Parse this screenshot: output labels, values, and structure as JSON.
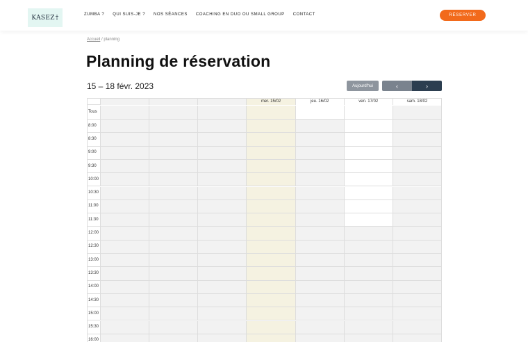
{
  "header": {
    "logo_text": "KASEZ",
    "logo_mark": "†",
    "nav": [
      "ZUMBA ?",
      "QUI SUIS-JE ?",
      "NOS SÉANCES",
      "COACHING EN DUO OU SMALL GROUP",
      "CONTACT"
    ],
    "reserve_label": "RÉSERVER"
  },
  "breadcrumb": {
    "home": "Accueil",
    "separator": "/",
    "current": "planning"
  },
  "page_title": "Planning de réservation",
  "toolbar": {
    "date_range": "15 – 18 févr. 2023",
    "today_label": "Aujourd'hui",
    "prev_icon": "‹",
    "next_icon": "›"
  },
  "calendar": {
    "columns": [
      "",
      "",
      "",
      "mer. 15/02",
      "jeu. 16/02",
      "ven. 17/02",
      "sam. 18/02"
    ],
    "all_day_label": "Tous",
    "times": [
      "8:00",
      "8:30",
      "9:00",
      "9:30",
      "10:00",
      "10:30",
      "11:00",
      "11:30",
      "12:00",
      "12:30",
      "13:00",
      "13:30",
      "14:00",
      "14:30",
      "15:00",
      "15:30",
      "16:00"
    ],
    "colors": {
      "unavailable": "#f2f2f2",
      "today": "#f5f2e1",
      "available": "#ffffff",
      "border": "#dddddd"
    },
    "available_slots": {
      "4": [
        -1
      ],
      "5": [
        -1,
        0,
        1,
        2,
        3,
        4,
        5,
        6,
        7
      ]
    }
  },
  "brand": {
    "accent": "#f26a1b",
    "nav_dark": "#2c3e50"
  }
}
